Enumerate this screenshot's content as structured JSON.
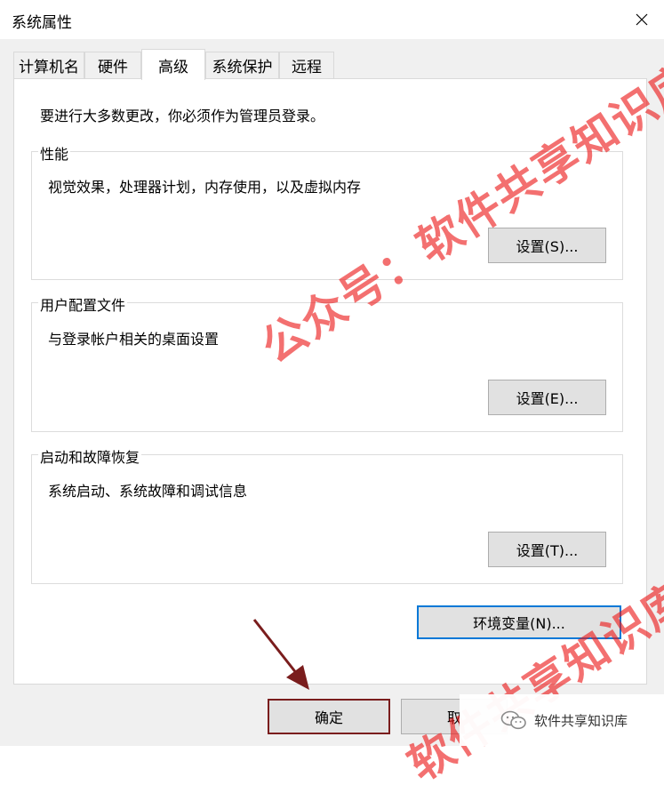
{
  "window": {
    "title": "系统属性"
  },
  "tabs": [
    {
      "label": "计算机名"
    },
    {
      "label": "硬件"
    },
    {
      "label": "高级"
    },
    {
      "label": "系统保护"
    },
    {
      "label": "远程"
    }
  ],
  "active_tab": "高级",
  "panel": {
    "note": "要进行大多数更改，你必须作为管理员登录。",
    "groups": [
      {
        "title": "性能",
        "description": "视觉效果，处理器计划，内存使用，以及虚拟内存",
        "button": "设置(S)..."
      },
      {
        "title": "用户配置文件",
        "description": "与登录帐户相关的桌面设置",
        "button": "设置(E)..."
      },
      {
        "title": "启动和故障恢复",
        "description": "系统启动、系统故障和调试信息",
        "button": "设置(T)..."
      }
    ],
    "env_button": "环境变量(N)..."
  },
  "footer": {
    "ok": "确定",
    "cancel": "取"
  },
  "overlay": {
    "watermark_top": "公众号：软件共享知识库",
    "watermark_bottom": "软件共享知识库",
    "badge_text": "软件共享知识库",
    "arrow_color": "#7a1d1d"
  }
}
